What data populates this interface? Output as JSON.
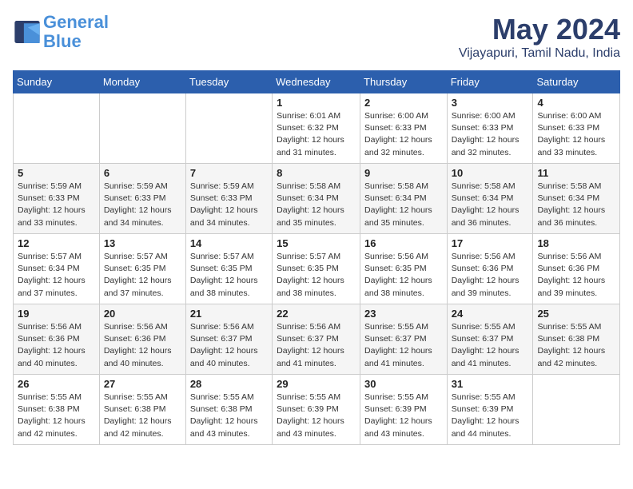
{
  "logo": {
    "line1": "General",
    "line2": "Blue"
  },
  "title": "May 2024",
  "subtitle": "Vijayapuri, Tamil Nadu, India",
  "weekdays": [
    "Sunday",
    "Monday",
    "Tuesday",
    "Wednesday",
    "Thursday",
    "Friday",
    "Saturday"
  ],
  "weeks": [
    [
      {
        "day": "",
        "info": ""
      },
      {
        "day": "",
        "info": ""
      },
      {
        "day": "",
        "info": ""
      },
      {
        "day": "1",
        "info": "Sunrise: 6:01 AM\nSunset: 6:32 PM\nDaylight: 12 hours\nand 31 minutes."
      },
      {
        "day": "2",
        "info": "Sunrise: 6:00 AM\nSunset: 6:33 PM\nDaylight: 12 hours\nand 32 minutes."
      },
      {
        "day": "3",
        "info": "Sunrise: 6:00 AM\nSunset: 6:33 PM\nDaylight: 12 hours\nand 32 minutes."
      },
      {
        "day": "4",
        "info": "Sunrise: 6:00 AM\nSunset: 6:33 PM\nDaylight: 12 hours\nand 33 minutes."
      }
    ],
    [
      {
        "day": "5",
        "info": "Sunrise: 5:59 AM\nSunset: 6:33 PM\nDaylight: 12 hours\nand 33 minutes."
      },
      {
        "day": "6",
        "info": "Sunrise: 5:59 AM\nSunset: 6:33 PM\nDaylight: 12 hours\nand 34 minutes."
      },
      {
        "day": "7",
        "info": "Sunrise: 5:59 AM\nSunset: 6:33 PM\nDaylight: 12 hours\nand 34 minutes."
      },
      {
        "day": "8",
        "info": "Sunrise: 5:58 AM\nSunset: 6:34 PM\nDaylight: 12 hours\nand 35 minutes."
      },
      {
        "day": "9",
        "info": "Sunrise: 5:58 AM\nSunset: 6:34 PM\nDaylight: 12 hours\nand 35 minutes."
      },
      {
        "day": "10",
        "info": "Sunrise: 5:58 AM\nSunset: 6:34 PM\nDaylight: 12 hours\nand 36 minutes."
      },
      {
        "day": "11",
        "info": "Sunrise: 5:58 AM\nSunset: 6:34 PM\nDaylight: 12 hours\nand 36 minutes."
      }
    ],
    [
      {
        "day": "12",
        "info": "Sunrise: 5:57 AM\nSunset: 6:34 PM\nDaylight: 12 hours\nand 37 minutes."
      },
      {
        "day": "13",
        "info": "Sunrise: 5:57 AM\nSunset: 6:35 PM\nDaylight: 12 hours\nand 37 minutes."
      },
      {
        "day": "14",
        "info": "Sunrise: 5:57 AM\nSunset: 6:35 PM\nDaylight: 12 hours\nand 38 minutes."
      },
      {
        "day": "15",
        "info": "Sunrise: 5:57 AM\nSunset: 6:35 PM\nDaylight: 12 hours\nand 38 minutes."
      },
      {
        "day": "16",
        "info": "Sunrise: 5:56 AM\nSunset: 6:35 PM\nDaylight: 12 hours\nand 38 minutes."
      },
      {
        "day": "17",
        "info": "Sunrise: 5:56 AM\nSunset: 6:36 PM\nDaylight: 12 hours\nand 39 minutes."
      },
      {
        "day": "18",
        "info": "Sunrise: 5:56 AM\nSunset: 6:36 PM\nDaylight: 12 hours\nand 39 minutes."
      }
    ],
    [
      {
        "day": "19",
        "info": "Sunrise: 5:56 AM\nSunset: 6:36 PM\nDaylight: 12 hours\nand 40 minutes."
      },
      {
        "day": "20",
        "info": "Sunrise: 5:56 AM\nSunset: 6:36 PM\nDaylight: 12 hours\nand 40 minutes."
      },
      {
        "day": "21",
        "info": "Sunrise: 5:56 AM\nSunset: 6:37 PM\nDaylight: 12 hours\nand 40 minutes."
      },
      {
        "day": "22",
        "info": "Sunrise: 5:56 AM\nSunset: 6:37 PM\nDaylight: 12 hours\nand 41 minutes."
      },
      {
        "day": "23",
        "info": "Sunrise: 5:55 AM\nSunset: 6:37 PM\nDaylight: 12 hours\nand 41 minutes."
      },
      {
        "day": "24",
        "info": "Sunrise: 5:55 AM\nSunset: 6:37 PM\nDaylight: 12 hours\nand 41 minutes."
      },
      {
        "day": "25",
        "info": "Sunrise: 5:55 AM\nSunset: 6:38 PM\nDaylight: 12 hours\nand 42 minutes."
      }
    ],
    [
      {
        "day": "26",
        "info": "Sunrise: 5:55 AM\nSunset: 6:38 PM\nDaylight: 12 hours\nand 42 minutes."
      },
      {
        "day": "27",
        "info": "Sunrise: 5:55 AM\nSunset: 6:38 PM\nDaylight: 12 hours\nand 42 minutes."
      },
      {
        "day": "28",
        "info": "Sunrise: 5:55 AM\nSunset: 6:38 PM\nDaylight: 12 hours\nand 43 minutes."
      },
      {
        "day": "29",
        "info": "Sunrise: 5:55 AM\nSunset: 6:39 PM\nDaylight: 12 hours\nand 43 minutes."
      },
      {
        "day": "30",
        "info": "Sunrise: 5:55 AM\nSunset: 6:39 PM\nDaylight: 12 hours\nand 43 minutes."
      },
      {
        "day": "31",
        "info": "Sunrise: 5:55 AM\nSunset: 6:39 PM\nDaylight: 12 hours\nand 44 minutes."
      },
      {
        "day": "",
        "info": ""
      }
    ]
  ]
}
